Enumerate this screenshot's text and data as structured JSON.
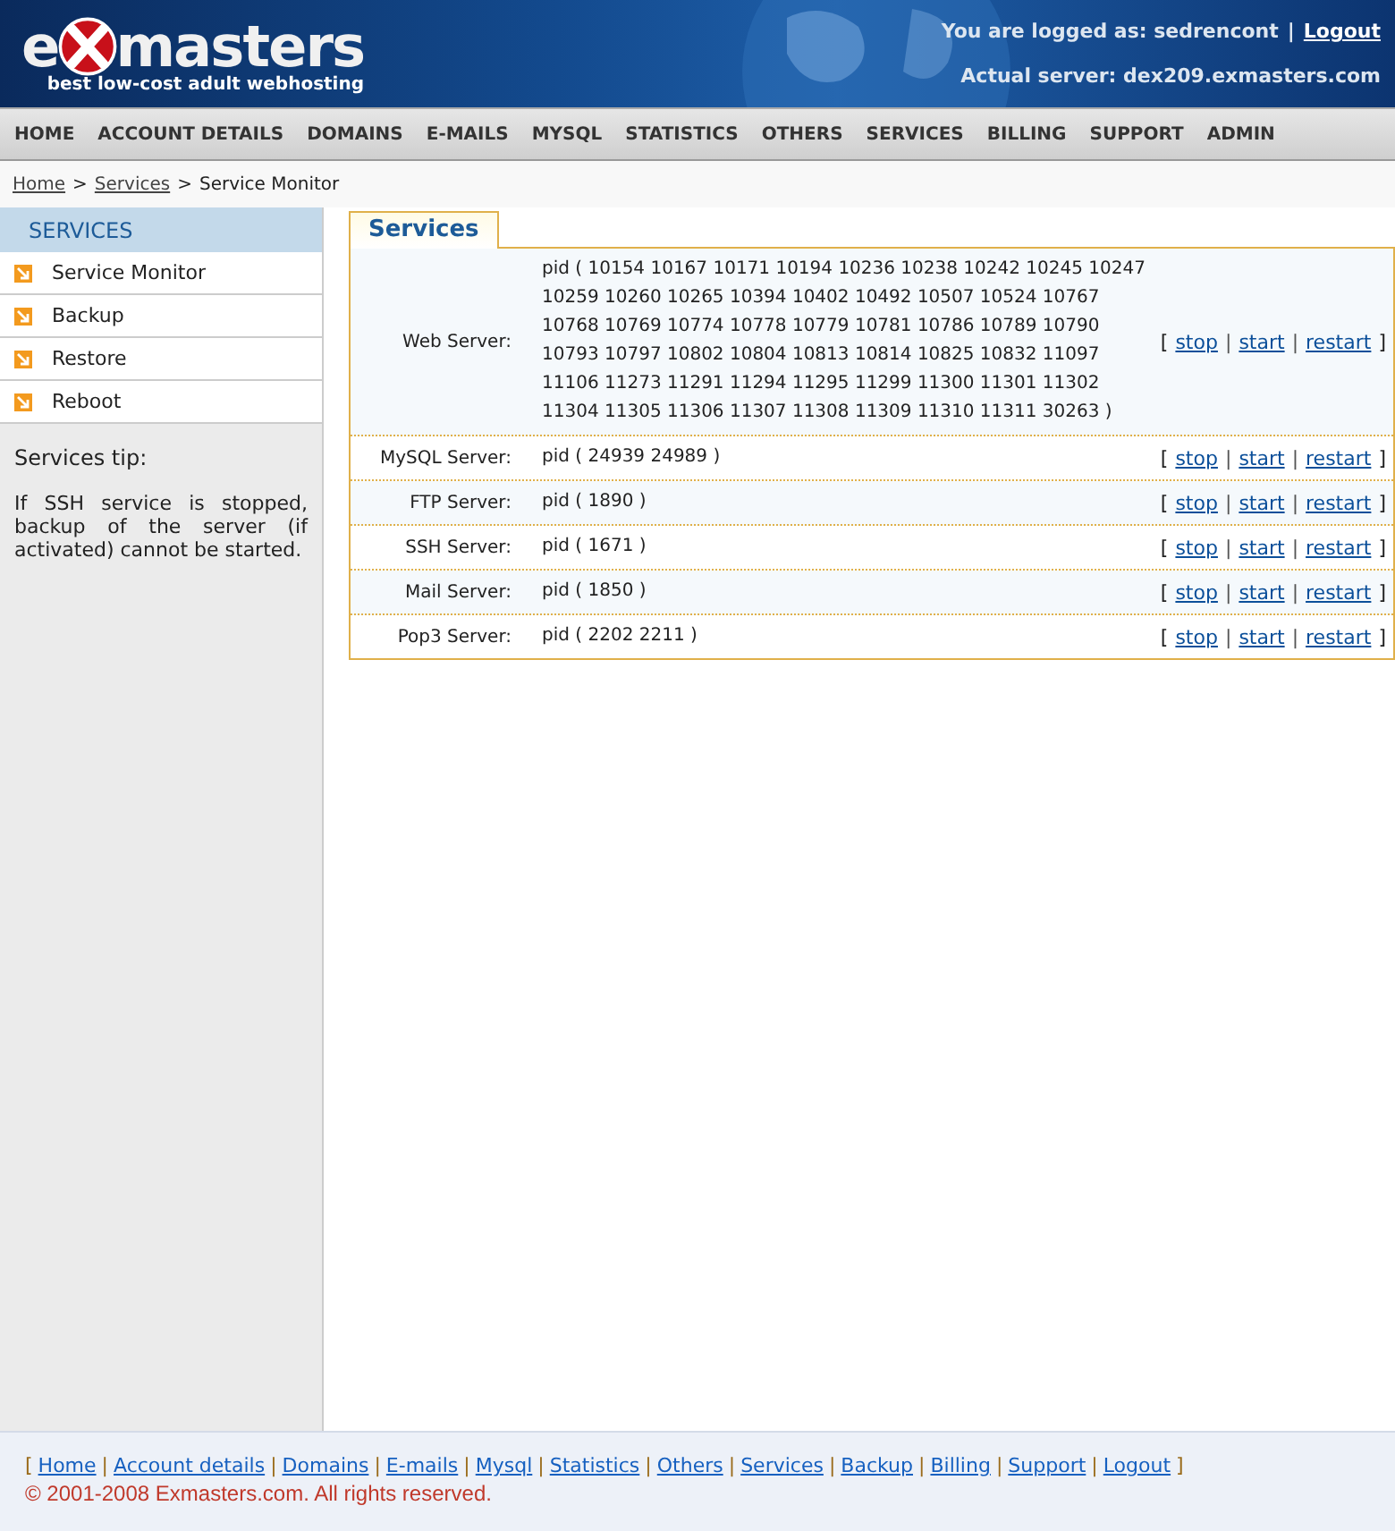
{
  "header": {
    "logo": {
      "letter": "e",
      "word": "masters",
      "tagline": "best low-cost adult webhosting"
    },
    "login_text": "You are logged as: sedrencont",
    "separator": "|",
    "logout": "Logout",
    "server_text": "Actual server: dex209.exmasters.com"
  },
  "nav": [
    {
      "label": "HOME",
      "selected": false
    },
    {
      "label": "ACCOUNT DETAILS",
      "selected": false
    },
    {
      "label": "DOMAINS",
      "selected": false
    },
    {
      "label": "E-MAILS",
      "selected": false
    },
    {
      "label": "MYSQL",
      "selected": false
    },
    {
      "label": "STATISTICS",
      "selected": false
    },
    {
      "label": "OTHERS",
      "selected": false
    },
    {
      "label": "SERVICES",
      "selected": false
    },
    {
      "label": "BILLING",
      "selected": false
    },
    {
      "label": "SUPPORT",
      "selected": false
    },
    {
      "label": "ADMIN",
      "selected": false
    }
  ],
  "breadcrumb": [
    {
      "kind": "link",
      "text": "Home"
    },
    {
      "kind": "sep",
      "text": ">"
    },
    {
      "kind": "link",
      "text": "Services"
    },
    {
      "kind": "sep",
      "text": ">"
    },
    {
      "kind": "current",
      "text": "Service Monitor"
    }
  ],
  "sidebar": {
    "title": "SERVICES",
    "items": [
      "Service Monitor",
      "Backup",
      "Restore",
      "Reboot"
    ],
    "tip_title": "Services tip:",
    "tip_text": "If SSH service is stopped, backup of the server (if activated) cannot be started."
  },
  "services": {
    "tab": "Services",
    "rows": [
      {
        "label": "Web Server:",
        "pids": "pid ( 10154 10167 10171 10194 10236 10238 10242 10245 10247 10259 10260 10265 10394 10402 10492 10507 10524 10767 10768 10769 10774 10778 10779 10781 10786 10789 10790 10793 10797 10802 10804 10813 10814 10825 10832 11097 11106 11273 11291 11294 11295 11299 11300 11301 11302 11304 11305 11306 11307 11308 11309 11310 11311 30263 )",
        "actions": {
          "open": "[",
          "links": [
            "stop",
            "start",
            "restart"
          ],
          "separators": [
            "|",
            "|"
          ],
          "close": "]"
        }
      },
      {
        "label": "MySQL Server:",
        "pids": "pid ( 24939 24989 )",
        "actions": {
          "open": "[",
          "links": [
            "stop",
            "start",
            "restart"
          ],
          "separators": [
            "|",
            "|"
          ],
          "close": "]"
        }
      },
      {
        "label": "FTP Server:",
        "pids": "pid ( 1890 )",
        "actions": {
          "open": "[",
          "links": [
            "stop",
            "start",
            "restart"
          ],
          "separators": [
            "|",
            "|"
          ],
          "close": "]"
        }
      },
      {
        "label": "SSH Server:",
        "pids": "pid ( 1671 )",
        "actions": {
          "open": "[",
          "links": [
            "stop",
            "start",
            "restart"
          ],
          "separators": [
            "|",
            "|"
          ],
          "close": "]"
        }
      },
      {
        "label": "Mail Server:",
        "pids": "pid ( 1850 )",
        "actions": {
          "open": "[",
          "links": [
            "stop",
            "start",
            "restart"
          ],
          "separators": [
            "|",
            "|"
          ],
          "close": "]"
        }
      },
      {
        "label": "Pop3 Server:",
        "pids": "pid ( 2202 2211 )",
        "actions": {
          "open": "[",
          "links": [
            "stop",
            "start",
            "restart"
          ],
          "separators": [
            "|",
            "|"
          ],
          "close": "]"
        }
      }
    ]
  },
  "footer": {
    "open": "[",
    "links": [
      "Home",
      "Account details",
      "Domains",
      "E-mails",
      "Mysql",
      "Statistics",
      "Others",
      "Services",
      "Backup",
      "Billing",
      "Support",
      "Logout"
    ],
    "separator": "|",
    "close": "]",
    "copyright": "© 2001-2008 Exmasters.com. All rights reserved."
  }
}
